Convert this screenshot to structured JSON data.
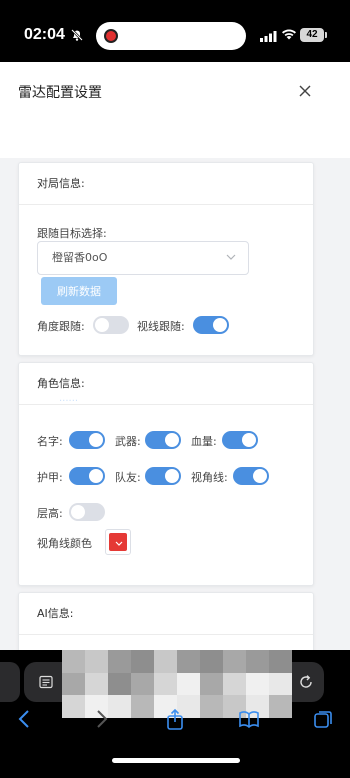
{
  "status_bar": {
    "time": "02:04",
    "battery": "42",
    "icons": [
      "bell-off-icon",
      "recording-icon",
      "signal-icon",
      "wifi-icon",
      "battery-icon"
    ]
  },
  "modal": {
    "title": "雷达配置设置"
  },
  "match_info": {
    "title": "对局信息:",
    "follow_target_label": "跟随目标选择:",
    "follow_target_value": "橙留香0oO",
    "refresh_button": "刷新数据",
    "angle_follow_label": "角度跟随:",
    "angle_follow_on": false,
    "sight_follow_label": "视线跟随:",
    "sight_follow_on": true
  },
  "character_info": {
    "title": "角色信息:",
    "toggles": [
      {
        "label": "名字:",
        "on": true
      },
      {
        "label": "武器:",
        "on": true
      },
      {
        "label": "血量:",
        "on": true
      },
      {
        "label": "护甲:",
        "on": true
      },
      {
        "label": "队友:",
        "on": true
      },
      {
        "label": "视角线:",
        "on": true
      },
      {
        "label": "层高:",
        "on": false
      }
    ],
    "sight_line_color_label": "视角线颜色",
    "sight_line_color": "#e53935"
  },
  "ai_info": {
    "title": "AI信息:"
  },
  "colors": {
    "accent": "#4a8fe0",
    "toggle_off": "#dcdfe6",
    "refresh_button": "#9ccaf5",
    "swatch": "#e53935"
  }
}
